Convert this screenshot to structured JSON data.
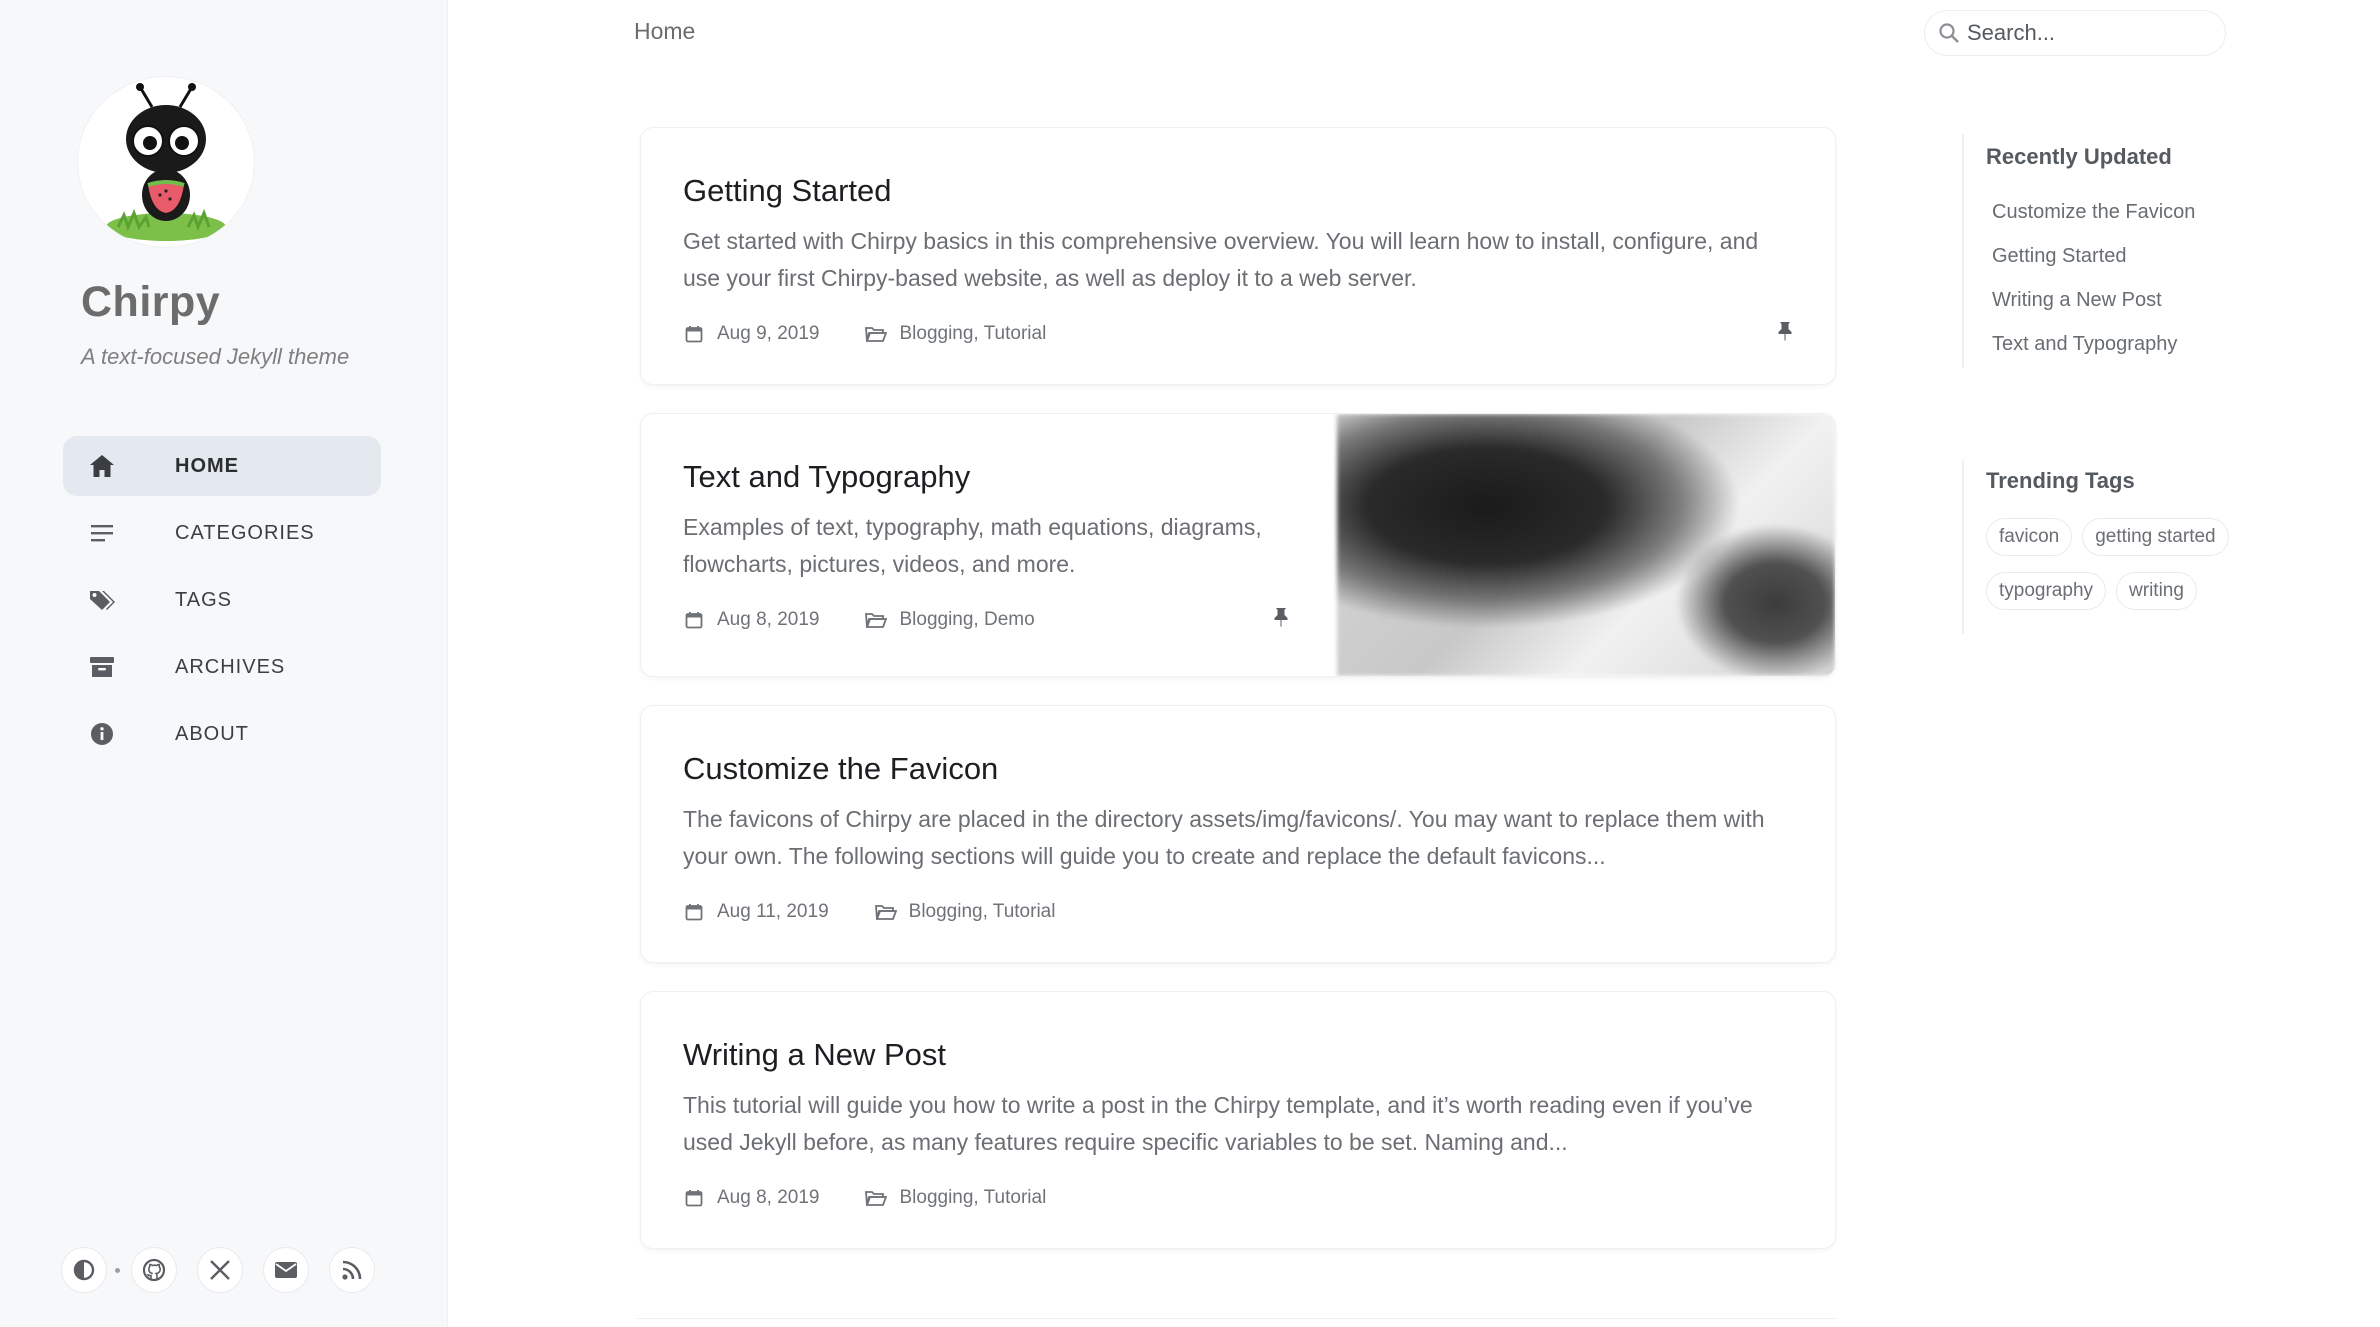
{
  "sidebar": {
    "title": "Chirpy",
    "subtitle": "A text-focused Jekyll theme",
    "nav": [
      {
        "label": "HOME",
        "icon": "home-icon",
        "active": true
      },
      {
        "label": "CATEGORIES",
        "icon": "list-icon",
        "active": false
      },
      {
        "label": "TAGS",
        "icon": "tags-icon",
        "active": false
      },
      {
        "label": "ARCHIVES",
        "icon": "archive-icon",
        "active": false
      },
      {
        "label": "ABOUT",
        "icon": "info-icon",
        "active": false
      }
    ],
    "bottom_icons": [
      "theme-toggle-icon",
      "github-icon",
      "x-twitter-icon",
      "email-icon",
      "rss-icon"
    ]
  },
  "topbar": {
    "breadcrumb": "Home",
    "search_placeholder": "Search..."
  },
  "posts": [
    {
      "title": "Getting Started",
      "excerpt": "Get started with Chirpy basics in this comprehensive overview. You will learn how to install, configure, and use your first Chirpy-based website, as well as deploy it to a web server.",
      "date": "Aug 9, 2019",
      "categories": "Blogging, Tutorial",
      "pinned": true
    },
    {
      "title": "Text and Typography",
      "excerpt": "Examples of text, typography, math equations, diagrams, flowcharts, pictures, videos, and more.",
      "date": "Aug 8, 2019",
      "categories": "Blogging, Demo",
      "pinned": true,
      "has_preview_image": true
    },
    {
      "title": "Customize the Favicon",
      "excerpt": "The favicons of Chirpy are placed in the directory assets/img/favicons/. You may want to replace them with your own. The following sections will guide you to create and replace the default favicons...",
      "date": "Aug 11, 2019",
      "categories": "Blogging, Tutorial",
      "pinned": false
    },
    {
      "title": "Writing a New Post",
      "excerpt": "This tutorial will guide you how to write a post in the Chirpy template, and it’s worth reading even if you’ve used Jekyll before, as many features require specific variables to be set. Naming and...",
      "date": "Aug 8, 2019",
      "categories": "Blogging, Tutorial",
      "pinned": false
    }
  ],
  "panel": {
    "recent_heading": "Recently Updated",
    "recent": [
      "Customize the Favicon",
      "Getting Started",
      "Writing a New Post",
      "Text and Typography"
    ],
    "tags_heading": "Trending Tags",
    "tags": [
      "favicon",
      "getting started",
      "typography",
      "writing"
    ]
  },
  "colors": {
    "sidebar_bg": "#f6f8fa",
    "active_nav_bg": "#e4e9ef",
    "text_primary": "#1e1e22",
    "text_muted": "#6b6e72"
  }
}
